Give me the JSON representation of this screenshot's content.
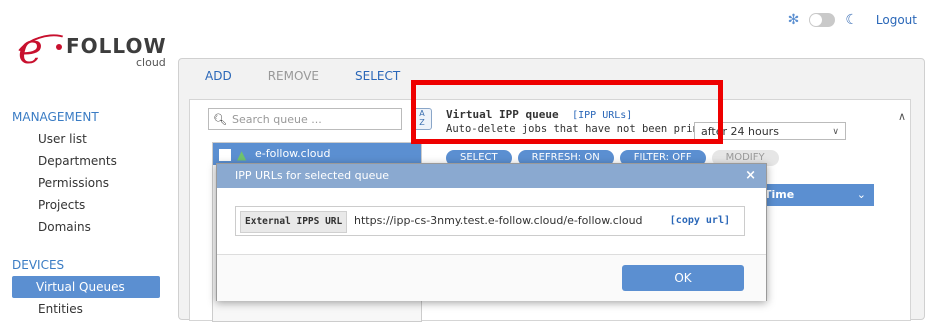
{
  "topbar": {
    "sun_icon": "sun-icon",
    "moon_icon": "moon-icon",
    "logout_label": "Logout"
  },
  "logo": {
    "e": "e",
    "brand": "FOLLOW",
    "sub": "cloud"
  },
  "sidebar": {
    "management_title": "MANAGEMENT",
    "management_items": [
      "User list",
      "Departments",
      "Permissions",
      "Projects",
      "Domains"
    ],
    "devices_title": "DEVICES",
    "devices_items": [
      "Virtual Queues",
      "Entities"
    ]
  },
  "tabs": {
    "add": "ADD",
    "remove": "REMOVE",
    "select": "SELECT"
  },
  "search": {
    "placeholder": "Search queue ..."
  },
  "az_button": "A\nZ",
  "queue": {
    "item_label": "e-follow.cloud"
  },
  "queue_info": {
    "title": "Virtual IPP queue",
    "ipp_urls_link": "[IPP URLs]",
    "auto_delete_text": "Auto-delete jobs that have not been printed",
    "auto_delete_value": "after 24 hours"
  },
  "action_buttons": {
    "select": "SELECT",
    "refresh": "REFRESH: ON",
    "filter": "FILTER: OFF",
    "modify": "MODIFY"
  },
  "table": {
    "header_time": "Time"
  },
  "modal": {
    "title": "IPP URLs for selected queue",
    "close": "×",
    "url_label": "External IPPS URL",
    "url_value": "https://ipp-cs-3nmy.test.e-follow.cloud/e-follow.cloud",
    "copy_label": "[copy url]",
    "ok_label": "OK"
  }
}
